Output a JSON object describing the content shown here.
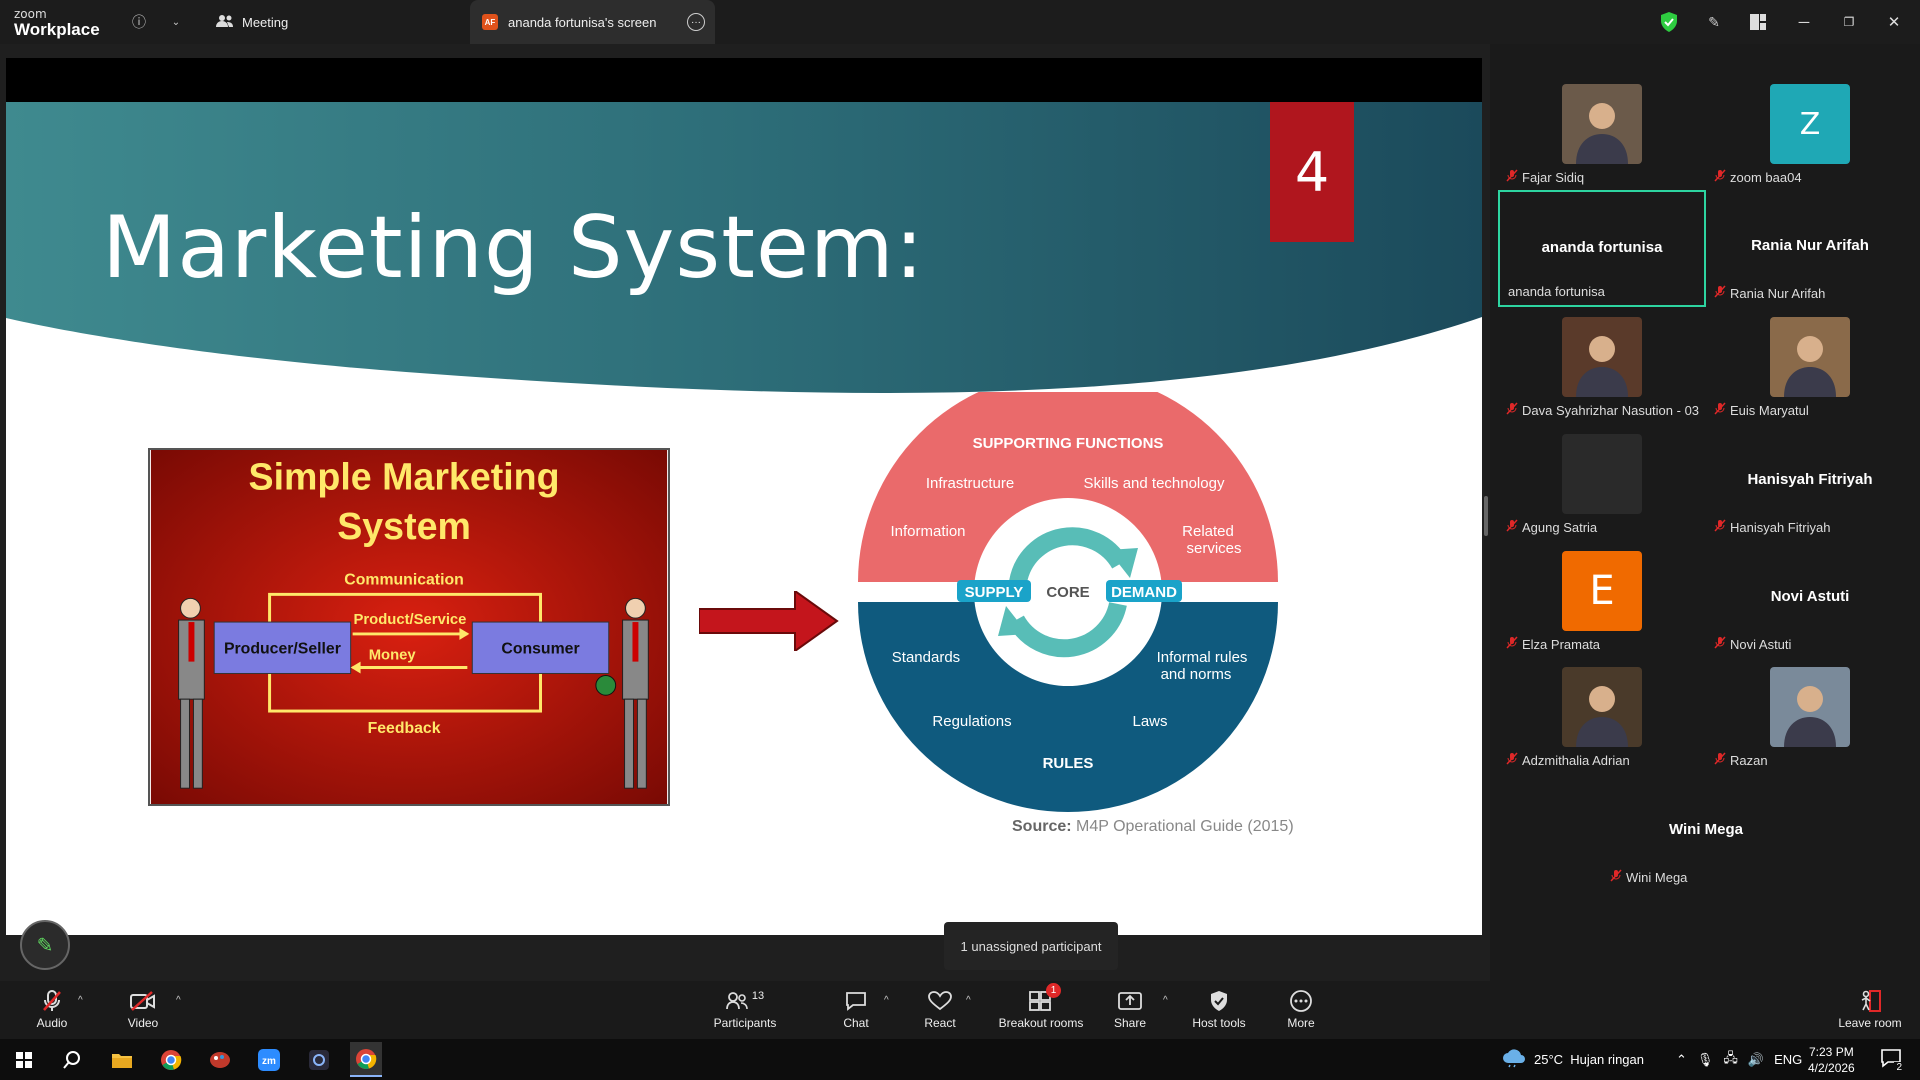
{
  "app": {
    "logo_line1": "zoom",
    "logo_line2": "Workplace",
    "meeting_tab": "Meeting",
    "screen_tab": "ananda fortunisa's screen",
    "screen_tab_initials": "AF"
  },
  "slide": {
    "title": "Marketing System:",
    "badge": "4",
    "left_image": {
      "title1": "Simple Marketing",
      "title2": "System",
      "communication": "Communication",
      "product_service": "Product/Service",
      "money": "Money",
      "feedback": "Feedback",
      "producer": "Producer/Seller",
      "consumer": "Consumer"
    },
    "diagram": {
      "supporting_functions": "SUPPORTING FUNCTIONS",
      "infrastructure": "Infrastructure",
      "skills": "Skills and technology",
      "information": "Information",
      "related_services_1": "Related",
      "related_services_2": "services",
      "supply": "SUPPLY",
      "core": "CORE",
      "demand": "DEMAND",
      "standards": "Standards",
      "informal_1": "Informal rules",
      "informal_2": "and norms",
      "regulations": "Regulations",
      "laws": "Laws",
      "rules": "RULES"
    },
    "source_label": "Source:",
    "source_text": "M4P Operational Guide (2015)"
  },
  "tooltip": "1 unassigned participant",
  "participants": [
    {
      "name": "Fajar Sidiq",
      "type": "photo",
      "muted": true
    },
    {
      "name": "zoom baa04",
      "type": "initial",
      "initial": "Z",
      "color": "#1fa8b5",
      "muted": true
    },
    {
      "name": "ananda fortunisa",
      "type": "name",
      "muted": false,
      "active": true
    },
    {
      "name": "Rania Nur Arifah",
      "type": "name",
      "muted": true
    },
    {
      "name": "Dava Syahrizhar Nasution - 03",
      "type": "photo",
      "muted": true
    },
    {
      "name": "Euis Maryatul",
      "type": "photo",
      "muted": true
    },
    {
      "name": "Agung Satria",
      "type": "blank",
      "muted": true
    },
    {
      "name": "Hanisyah Fitriyah",
      "type": "name",
      "muted": true
    },
    {
      "name": "Elza Pramata",
      "type": "initial",
      "initial": "E",
      "color": "#f06a00",
      "muted": true
    },
    {
      "name": "Novi Astuti",
      "type": "name",
      "muted": true
    },
    {
      "name": "Adzmithalia Adrian",
      "type": "photo",
      "muted": true
    },
    {
      "name": "Razan",
      "type": "photo",
      "muted": true
    },
    {
      "name": "Wini Mega",
      "type": "name",
      "muted": true
    }
  ],
  "toolbar": {
    "audio": "Audio",
    "video": "Video",
    "participants": "Participants",
    "participants_count": "13",
    "chat": "Chat",
    "react": "React",
    "breakout": "Breakout rooms",
    "breakout_badge": "1",
    "share": "Share",
    "host_tools": "Host tools",
    "more": "More",
    "leave": "Leave room"
  },
  "taskbar": {
    "weather": "25°C  Hujan ringan",
    "lang": "ENG",
    "time": "7:23 PM",
    "date": "4/2/2026",
    "notif": "2"
  }
}
